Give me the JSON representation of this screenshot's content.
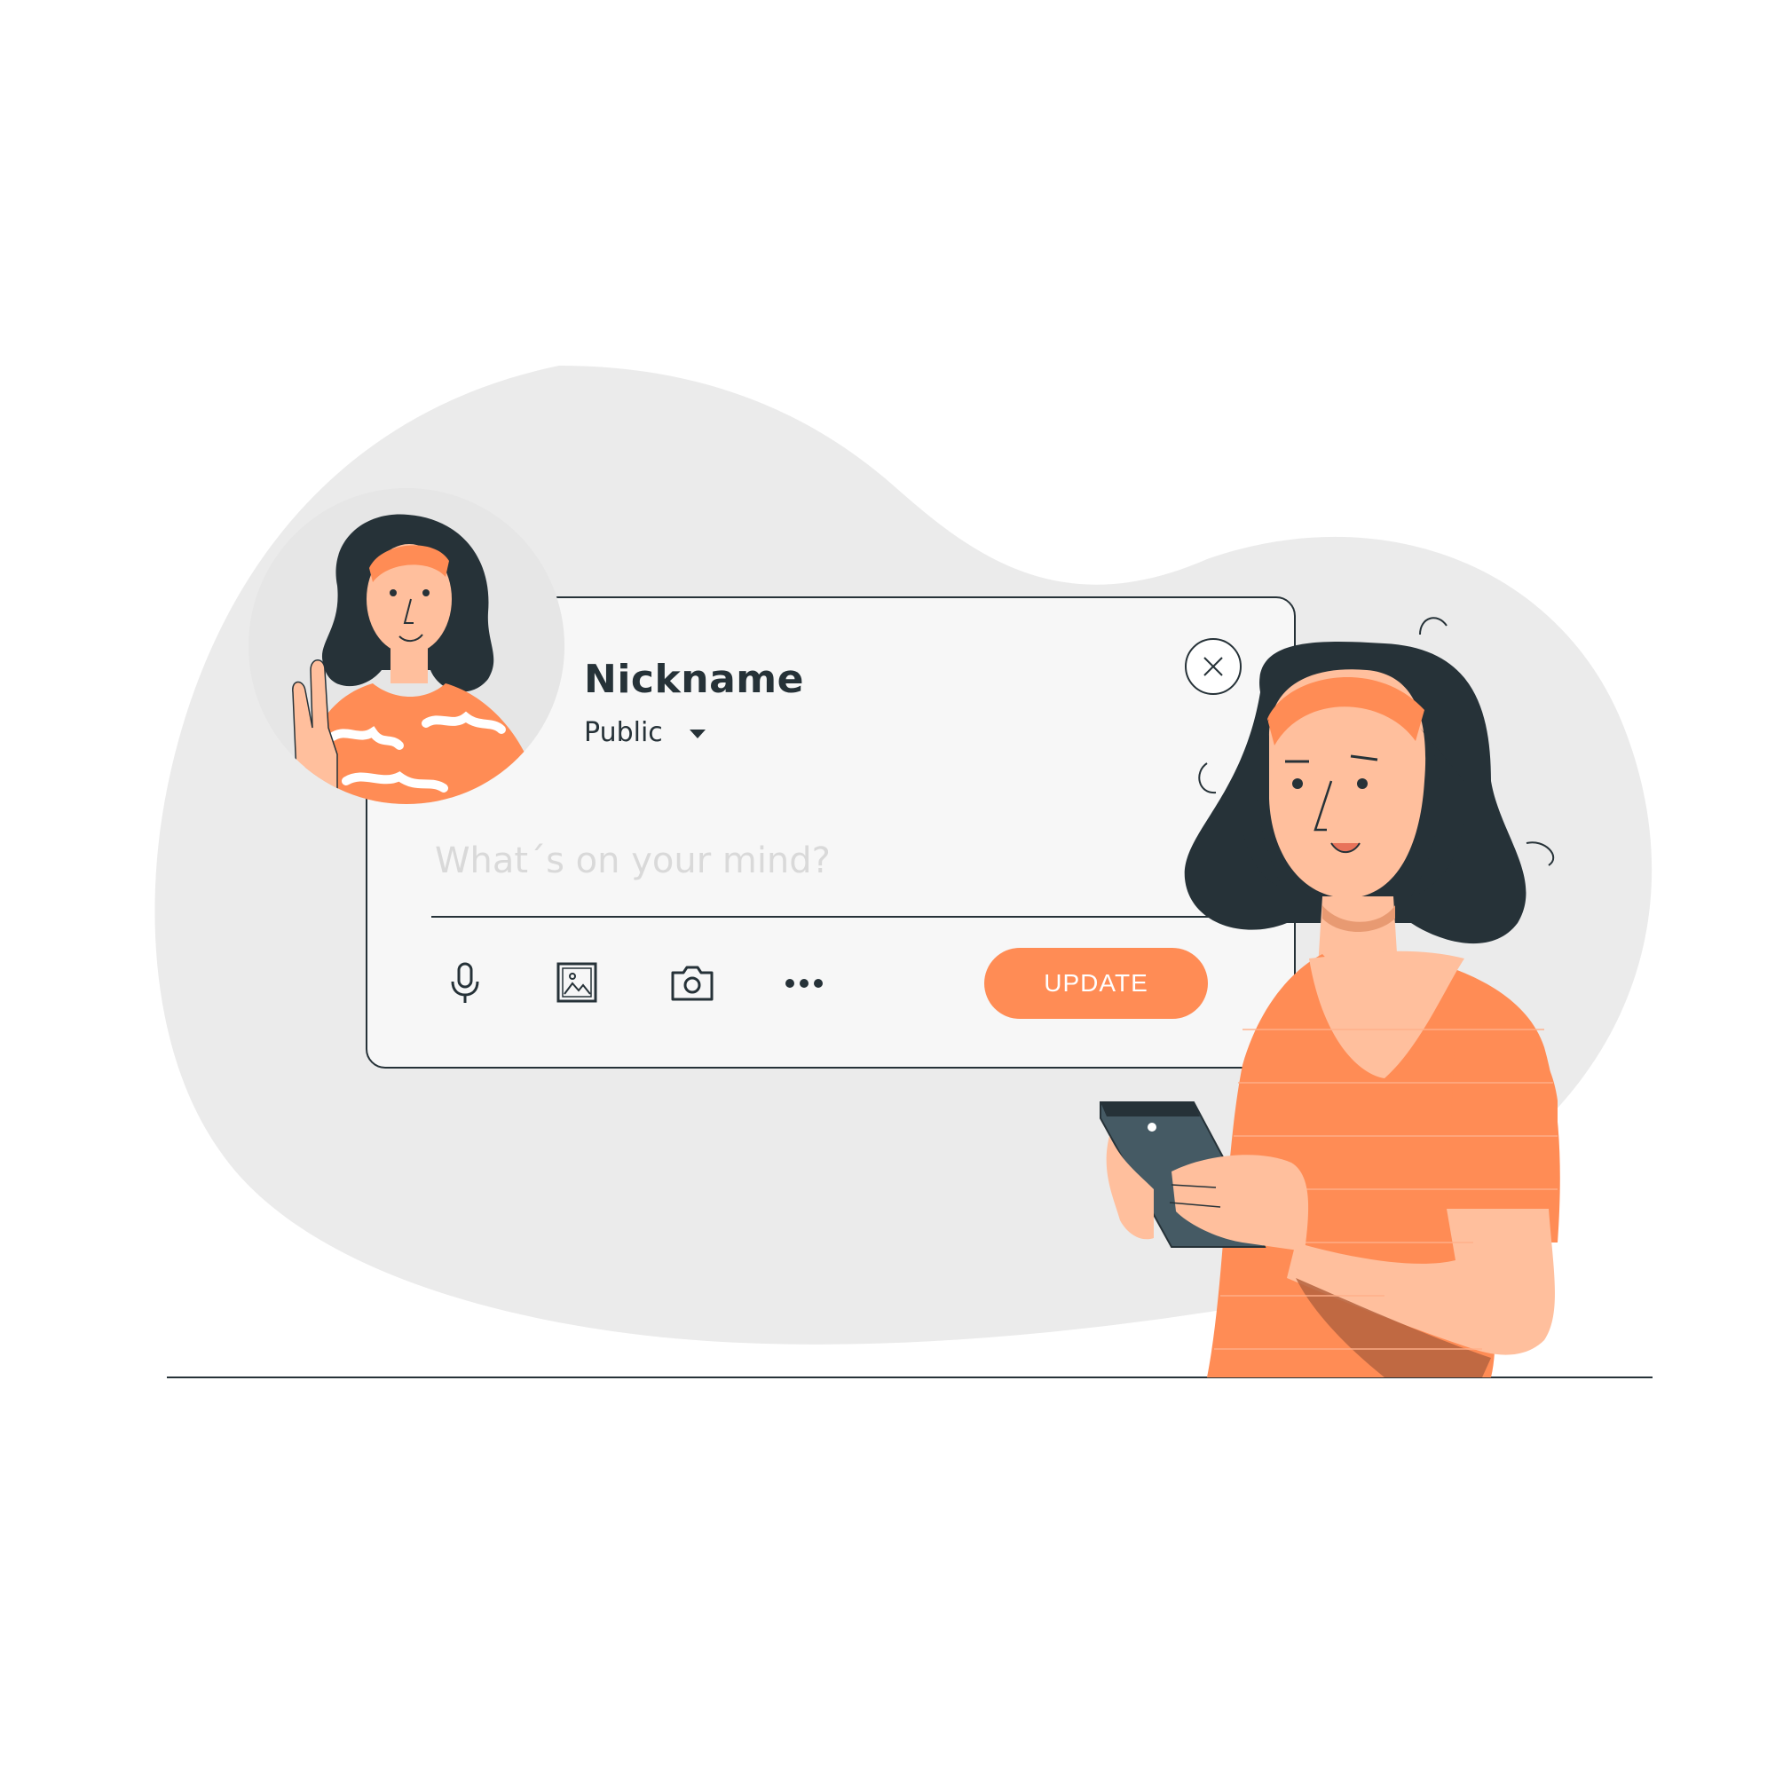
{
  "profile": {
    "nickname": "Nickname",
    "visibility": "Public"
  },
  "composer": {
    "placeholder": "What´s on your mind?",
    "update_label": "UPDATE"
  },
  "icons": [
    "microphone-icon",
    "image-icon",
    "camera-icon",
    "more-icon",
    "close-icon",
    "caret-down-icon"
  ],
  "colors": {
    "accent": "#ff8c55",
    "dark": "#263238",
    "blob": "#ebebeb",
    "skin": "#ffbf9d"
  }
}
